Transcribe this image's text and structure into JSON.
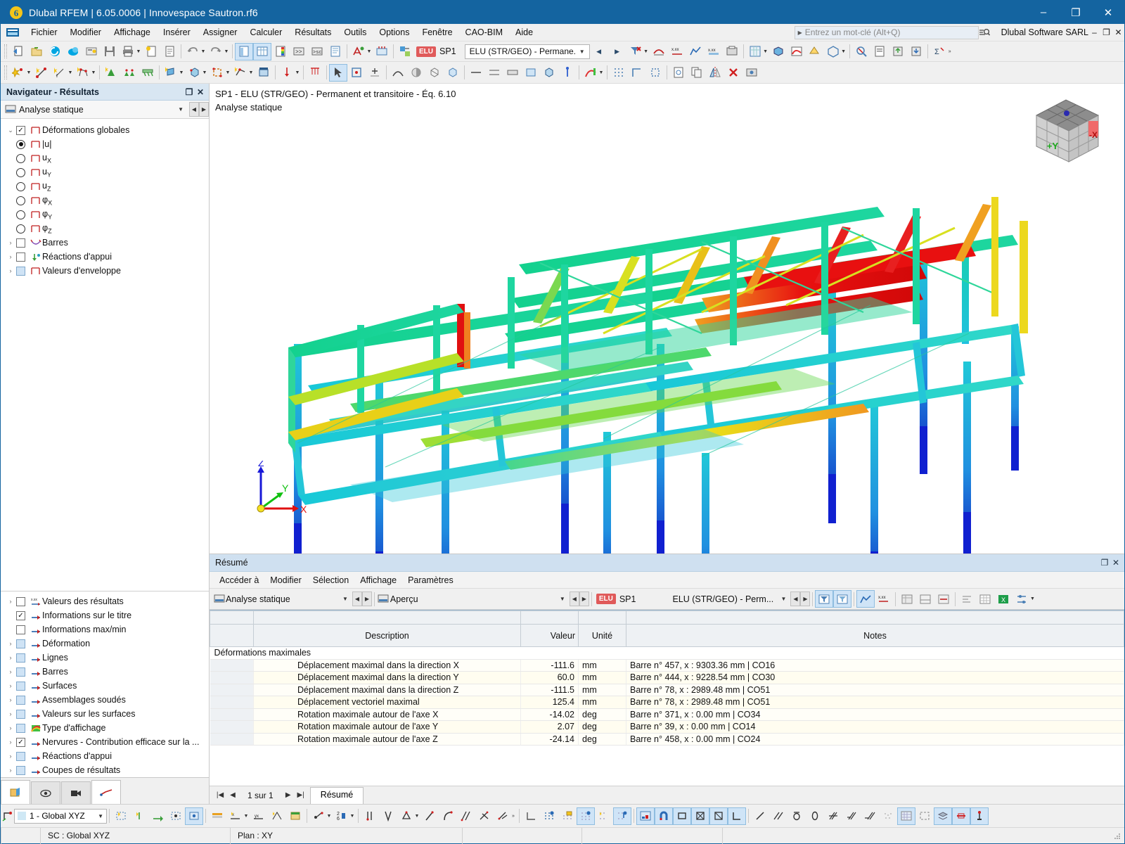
{
  "window": {
    "title": "Dlubal RFEM | 6.05.0006 | Innovespace Sautron.rf6",
    "app_icon": "dlubal-logo-icon",
    "minimize": "–",
    "maximize": "❐",
    "close": "✕"
  },
  "menubar": {
    "items": [
      "Fichier",
      "Modifier",
      "Affichage",
      "Insérer",
      "Assigner",
      "Calculer",
      "Résultats",
      "Outils",
      "Options",
      "Fenêtre",
      "CAO-BIM",
      "Aide"
    ],
    "search_placeholder": "Entrez un mot-clé (Alt+Q)",
    "company": "Dlubal Software SARL",
    "min": "–",
    "restore": "❐",
    "close": "✕"
  },
  "toolbar": {
    "elu_chip": "ELU",
    "sp_label": "SP1",
    "load_combo_value": "ELU (STR/GEO) - Permane...",
    "prev": "◀",
    "next": "▶"
  },
  "navigator": {
    "title": "Navigateur - Résultats",
    "restore_icon": "restore-icon",
    "close_icon": "close-icon",
    "selector": "Analyse statique",
    "tree_top": [
      {
        "label": "Déformations globales",
        "type": "check",
        "checked": true,
        "expanded": true,
        "indent": 0,
        "icon": "deformation-icon"
      },
      {
        "label": "|u|",
        "type": "radio",
        "selected": true,
        "indent": 1,
        "icon": "deformation-icon"
      },
      {
        "label": "u",
        "sub": "X",
        "type": "radio",
        "selected": false,
        "indent": 1,
        "icon": "deformation-icon"
      },
      {
        "label": "u",
        "sub": "Y",
        "type": "radio",
        "selected": false,
        "indent": 1,
        "icon": "deformation-icon"
      },
      {
        "label": "u",
        "sub": "Z",
        "type": "radio",
        "selected": false,
        "indent": 1,
        "icon": "deformation-icon"
      },
      {
        "label": "φ",
        "sub": "X",
        "type": "radio",
        "selected": false,
        "indent": 1,
        "icon": "deformation-icon"
      },
      {
        "label": "φ",
        "sub": "Y",
        "type": "radio",
        "selected": false,
        "indent": 1,
        "icon": "deformation-icon"
      },
      {
        "label": "φ",
        "sub": "Z",
        "type": "radio",
        "selected": false,
        "indent": 1,
        "icon": "deformation-icon"
      },
      {
        "label": "Barres",
        "type": "check",
        "checked": false,
        "collapsed": true,
        "indent": 0,
        "icon": "members-icon"
      },
      {
        "label": "Réactions d'appui",
        "type": "check",
        "checked": false,
        "collapsed": true,
        "indent": 0,
        "icon": "support-reactions-icon"
      },
      {
        "label": "Valeurs d'enveloppe",
        "type": "check",
        "checked": false,
        "blue": true,
        "collapsed": true,
        "indent": 0,
        "icon": "envelope-icon"
      }
    ],
    "tree_bottom": [
      {
        "label": "Valeurs des résultats",
        "type": "check",
        "checked": false,
        "collapsed": true,
        "icon": "result-values-icon"
      },
      {
        "label": "Informations sur le titre",
        "type": "check",
        "checked": true,
        "collapsed": false,
        "icon": "title-info-icon"
      },
      {
        "label": "Informations max/min",
        "type": "check",
        "checked": false,
        "collapsed": false,
        "icon": "maxmin-icon"
      },
      {
        "label": "Déformation",
        "type": "check",
        "checked": false,
        "blue": true,
        "collapsed": true,
        "icon": "deformation-display-icon"
      },
      {
        "label": "Lignes",
        "type": "check",
        "checked": false,
        "blue": true,
        "collapsed": true,
        "icon": "lines-icon"
      },
      {
        "label": "Barres",
        "type": "check",
        "checked": false,
        "blue": true,
        "collapsed": true,
        "icon": "members-display-icon"
      },
      {
        "label": "Surfaces",
        "type": "check",
        "checked": false,
        "blue": true,
        "collapsed": true,
        "icon": "surfaces-icon"
      },
      {
        "label": "Assemblages soudés",
        "type": "check",
        "checked": false,
        "blue": true,
        "collapsed": true,
        "icon": "welded-joints-icon"
      },
      {
        "label": "Valeurs sur les surfaces",
        "type": "check",
        "checked": false,
        "blue": true,
        "collapsed": true,
        "icon": "surface-values-icon"
      },
      {
        "label": "Type d'affichage",
        "type": "check",
        "checked": false,
        "blue": true,
        "collapsed": true,
        "icon": "display-type-icon"
      },
      {
        "label": "Nervures - Contribution efficace sur la ...",
        "type": "check",
        "checked": true,
        "collapsed": true,
        "icon": "ribs-icon"
      },
      {
        "label": "Réactions d'appui",
        "type": "check",
        "checked": false,
        "blue": true,
        "collapsed": true,
        "icon": "support-reactions-display-icon"
      },
      {
        "label": "Coupes de résultats",
        "type": "check",
        "checked": false,
        "blue": true,
        "collapsed": true,
        "icon": "result-sections-icon"
      }
    ],
    "tabs": [
      "project-navigator-tab",
      "view-navigator-tab",
      "render-navigator-tab",
      "results-navigator-tab"
    ]
  },
  "viewport": {
    "title_line1": "SP1 - ELU (STR/GEO) - Permanent et transitoire - Éq. 6.10",
    "title_line2": "Analyse statique",
    "axes": {
      "x": "X",
      "y": "Y",
      "z": "Z"
    },
    "viewcube": {
      "face_left": "+Y",
      "face_right": "-X"
    }
  },
  "resume": {
    "title": "Résumé",
    "restore_icon": "restore-icon",
    "close_icon": "close-icon",
    "menu": [
      "Accéder à",
      "Modifier",
      "Sélection",
      "Affichage",
      "Paramètres"
    ],
    "analysis_combo": "Analyse statique",
    "view_combo": "Aperçu",
    "elu_chip": "ELU",
    "sp_label": "SP1",
    "load_combo": "ELU (STR/GEO) - Perm...",
    "columns": [
      "",
      "Description",
      "Valeur",
      "Unité",
      "Notes"
    ],
    "group_row": "Déformations maximales",
    "rows": [
      {
        "description": "Déplacement maximal dans la direction X",
        "value": "-111.6",
        "unit": "mm",
        "notes": "Barre n° 457, x : 9303.36 mm | CO16"
      },
      {
        "description": "Déplacement maximal dans la direction Y",
        "value": "60.0",
        "unit": "mm",
        "notes": "Barre n° 444, x : 9228.54 mm | CO30"
      },
      {
        "description": "Déplacement maximal dans la direction Z",
        "value": "-111.5",
        "unit": "mm",
        "notes": "Barre n° 78, x : 2989.48 mm | CO51"
      },
      {
        "description": "Déplacement vectoriel maximal",
        "value": "125.4",
        "unit": "mm",
        "notes": "Barre n° 78, x : 2989.48 mm | CO51"
      },
      {
        "description": "Rotation maximale autour de l'axe X",
        "value": "-14.02",
        "unit": "deg",
        "notes": "Barre n° 371, x : 0.00 mm | CO34"
      },
      {
        "description": "Rotation maximale autour de l'axe Y",
        "value": "2.07",
        "unit": "deg",
        "notes": "Barre n° 39, x : 0.00 mm | CO14"
      },
      {
        "description": "Rotation maximale autour de l'axe Z",
        "value": "-24.14",
        "unit": "deg",
        "notes": "Barre n° 458, x : 0.00 mm | CO24"
      }
    ],
    "pager": "1 sur 1",
    "tab": "Résumé"
  },
  "statusbar": {
    "cs_combo": "1 - Global XYZ",
    "sc_label": "SC : Global XYZ",
    "plan_label": "Plan : XY"
  },
  "colors": {
    "titlebar": "#1464a0",
    "accent": "#1464a0",
    "elu_chip": "#e05a5a",
    "panel_header": "#cfe0f0",
    "table_row": "#fffdf0"
  }
}
